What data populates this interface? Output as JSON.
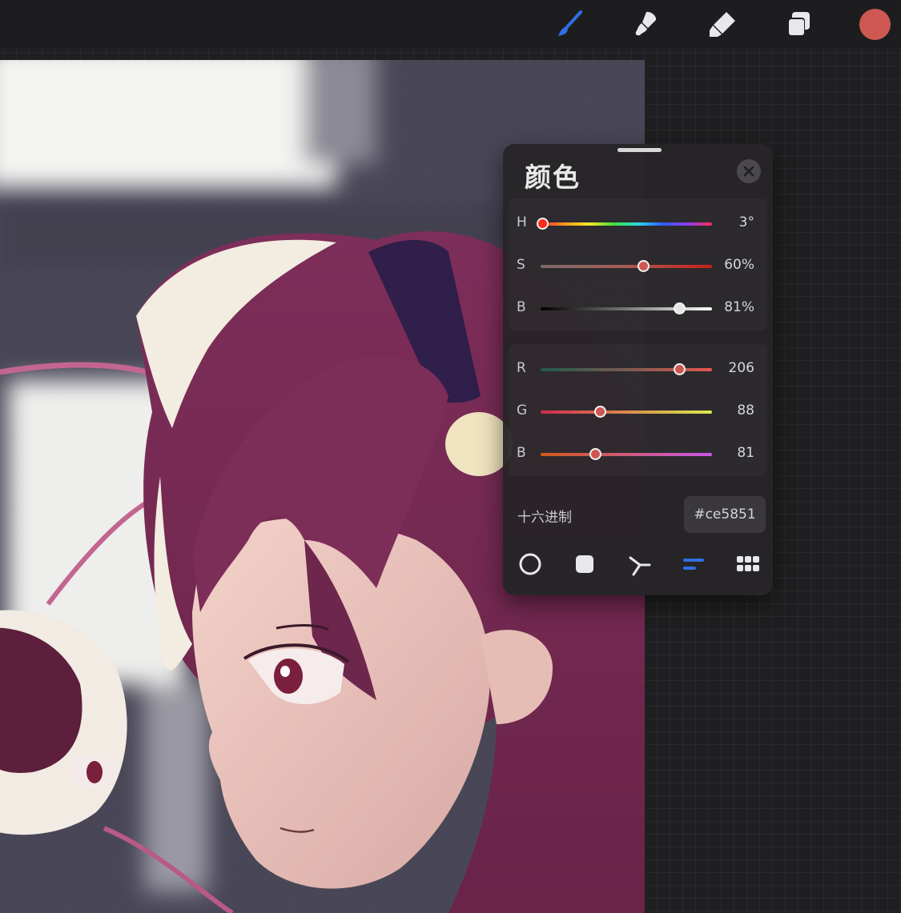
{
  "toolbar": {
    "tools": [
      {
        "name": "brush-icon",
        "active": true
      },
      {
        "name": "smudge-icon",
        "active": false
      },
      {
        "name": "eraser-icon",
        "active": false
      },
      {
        "name": "layers-icon",
        "active": false
      }
    ],
    "current_color": "#ce5851",
    "active_color": "#2f6fe3"
  },
  "color_panel": {
    "title": "颜色",
    "hsb": [
      {
        "label": "H",
        "value": "3°",
        "level": 0.01
      },
      {
        "label": "S",
        "value": "60%",
        "level": 0.6
      },
      {
        "label": "B",
        "value": "81%",
        "level": 0.81
      }
    ],
    "rgb": [
      {
        "label": "R",
        "value": "206",
        "level": 0.808
      },
      {
        "label": "G",
        "value": "88",
        "level": 0.345
      },
      {
        "label": "B",
        "value": "81",
        "level": 0.318
      }
    ],
    "hex_label": "十六进制",
    "hex_value": "#ce5851",
    "modes": [
      {
        "name": "disc-mode-icon",
        "active": false
      },
      {
        "name": "classic-mode-icon",
        "active": false
      },
      {
        "name": "harmony-mode-icon",
        "active": false
      },
      {
        "name": "value-mode-icon",
        "active": true
      },
      {
        "name": "palettes-mode-icon",
        "active": false
      }
    ]
  }
}
